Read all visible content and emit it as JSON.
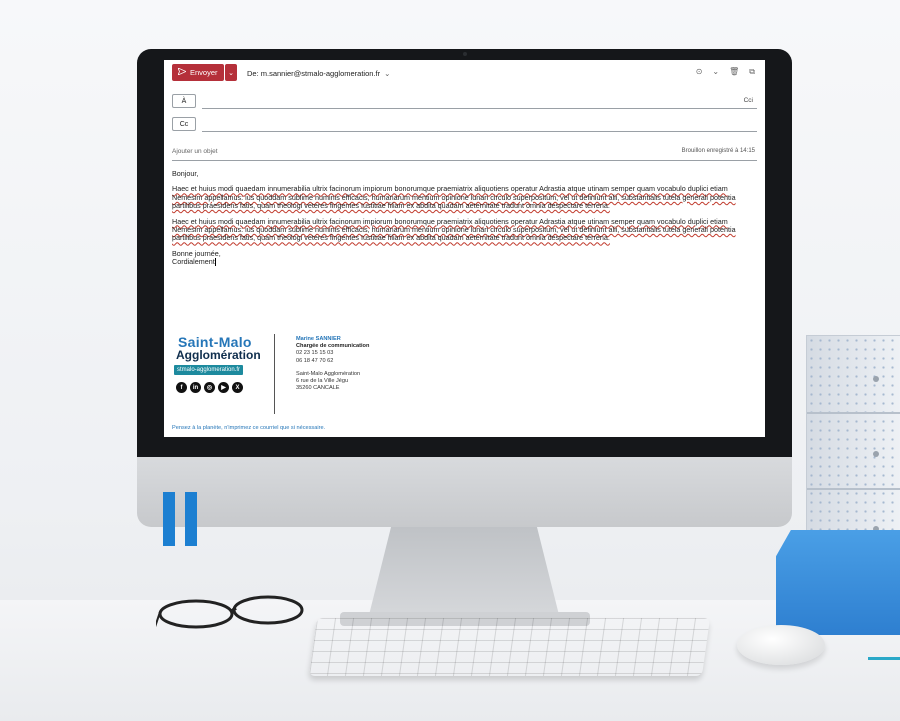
{
  "compose": {
    "send_label": "Envoyer",
    "from_label": "De: m.sannier@stmalo-agglomeration.fr",
    "to_button": "À",
    "cci_label": "Cci",
    "cc_button": "Cc",
    "subject_placeholder": "Ajouter un objet",
    "saved_status": "Brouillon enregistré à 14:15"
  },
  "body": {
    "greeting": "Bonjour,",
    "paragraph1": "Haec et huius modi quaedam innumerabilia ultrix facinorum impiorum bonorumque praemiatrix aliquotiens operatur Adrastia atque utinam semper quam vocabulo duplici etiam Nemesim appellamus: ius quoddam sublime numinis efficacis, humanarum mentium opinione lunari circulo superpositum, vel ut definiunt alii, substantialis tutela generali potentia partilibus praesidens fatis, quam theologi veteres fingentes Iustitiae filiam ex abdita quadam aeternitate tradunt omnia despectare terrena.",
    "paragraph2": "Haec et huius modi quaedam innumerabilia ultrix facinorum impiorum bonorumque praemiatrix aliquotiens operatur Adrastia atque utinam semper quam vocabulo duplici etiam Nemesim appellamus: ius quoddam sublime numinis efficacis, humanarum mentium opinione lunari circulo superpositum, vel ut definiunt alii, substantialis tutela generali potentia partilibus praesidens fatis, quam theologi veteres fingentes Iustitiae filiam ex abdita quadam aeternitate tradunt omnia despectare terrena.",
    "closing1": "Bonne journée,",
    "closing2": "Cordialement"
  },
  "signature": {
    "logo_line1": "Saint-Malo",
    "logo_line2": "Agglomération",
    "url_badge": "stmalo-agglomeration.fr",
    "socials": [
      "facebook-icon",
      "linkedin-icon",
      "instagram-icon",
      "youtube-icon",
      "x-icon"
    ],
    "name": "Marine SANNIER",
    "role": "Chargée de communication",
    "phone1": "02 23 15 15 03",
    "phone2": "06 18 47 70 62",
    "org": "Saint-Malo Agglomération",
    "address1": "6 rue de la Ville Jégu",
    "address2": "35260 CANCALE"
  },
  "footer": "Pensez à la planète, n'imprimez ce courriel que si nécessaire.",
  "colors": {
    "send": "#b5303a",
    "brand_blue": "#2576b8",
    "badge_teal": "#1d8a9e"
  }
}
